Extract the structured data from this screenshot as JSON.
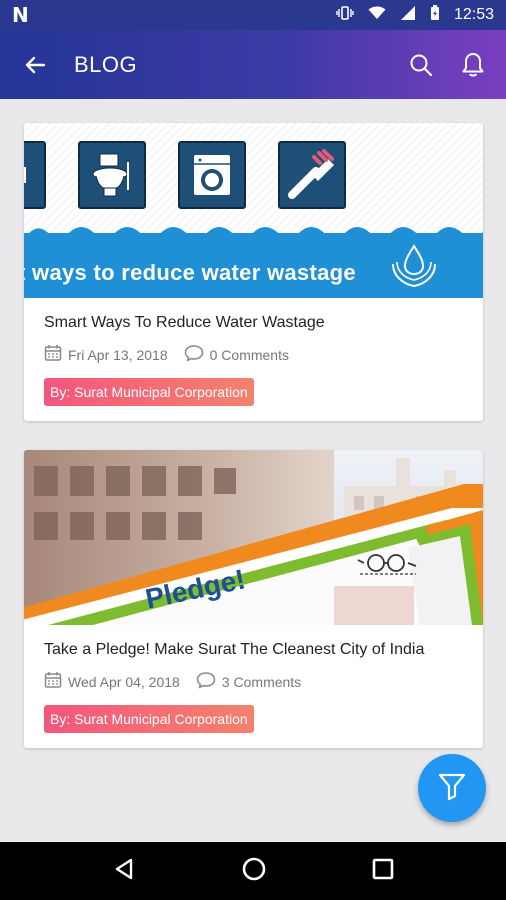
{
  "status_bar": {
    "time": "12:53"
  },
  "app_bar": {
    "title": "BLOG"
  },
  "posts": [
    {
      "banner_text": "t ways to reduce water wastage",
      "title": "Smart Ways To Reduce Water Wastage",
      "date": "Fri Apr 13, 2018",
      "comments": "0 Comments",
      "author": "By: Surat Municipal Corporation"
    },
    {
      "banner_text": "Pledge!",
      "title": "Take a Pledge! Make Surat The Cleanest City of India",
      "date": "Wed Apr 04, 2018",
      "comments": "3 Comments",
      "author": "By: Surat Municipal Corporation"
    }
  ],
  "colors": {
    "app_bar_start": "#253597",
    "app_bar_end": "#7a3fc1",
    "fab": "#2196f3",
    "tag_start": "#f2577e",
    "tag_end": "#f5816c"
  },
  "icons": [
    "back-arrow-icon",
    "search-icon",
    "bell-icon",
    "calendar-icon",
    "comment-icon",
    "filter-icon",
    "nav-back-icon",
    "nav-home-icon",
    "nav-recents-icon"
  ]
}
